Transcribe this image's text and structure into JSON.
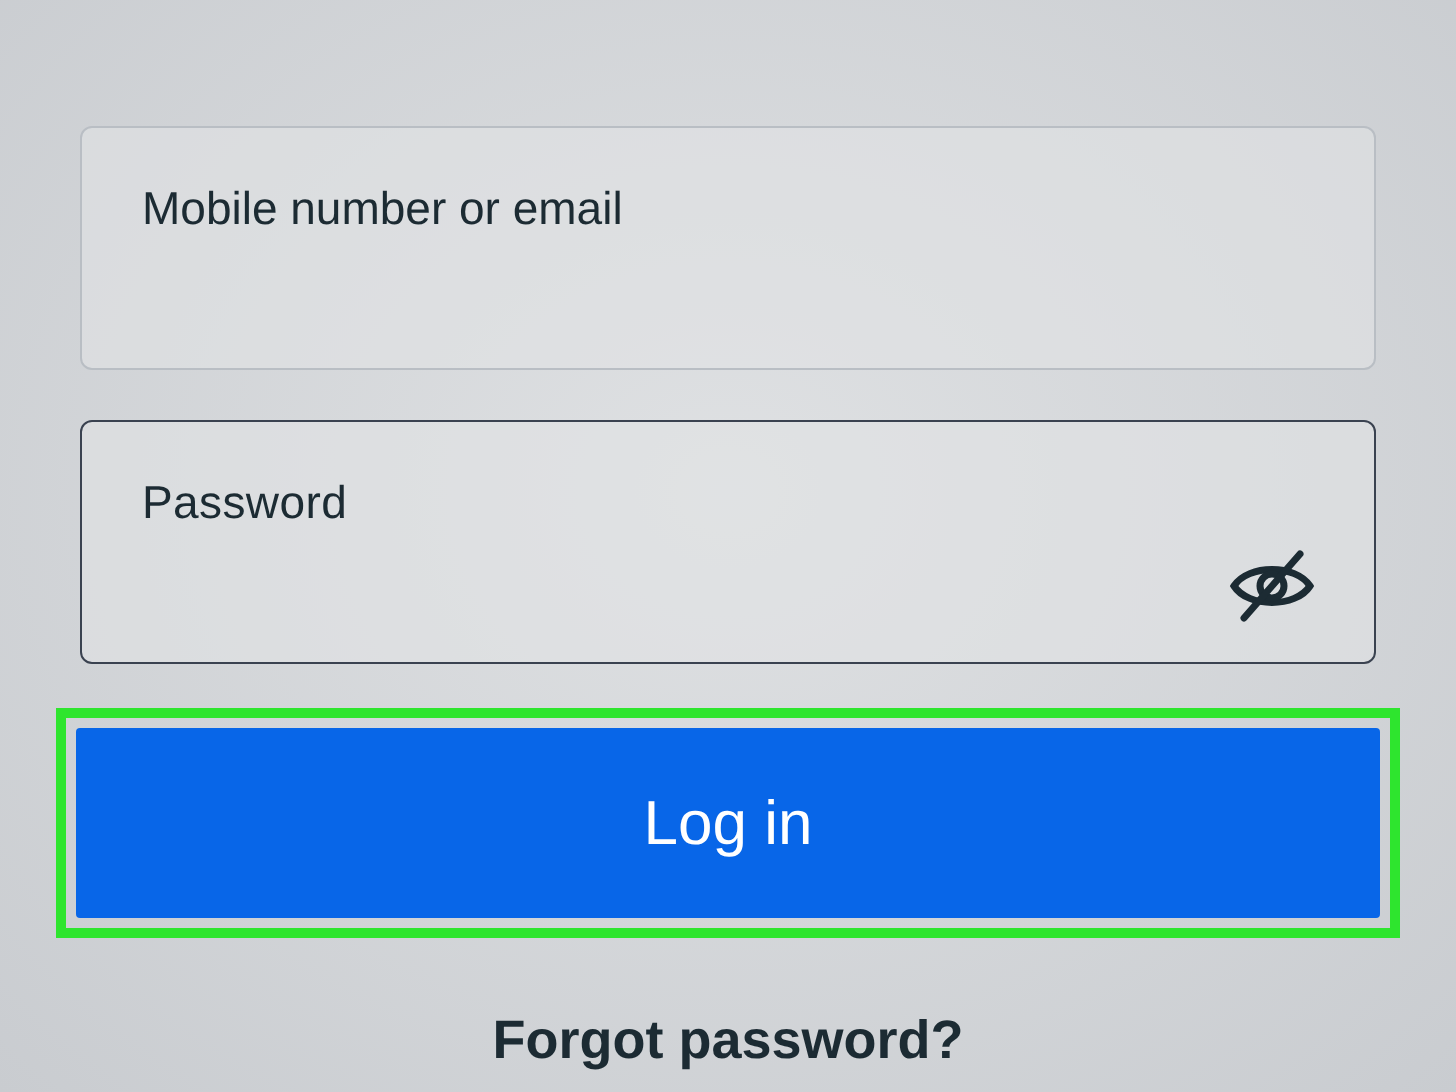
{
  "fields": [
    {
      "placeholder": "Mobile number or email",
      "kind": "text",
      "focused": false
    },
    {
      "placeholder": "Password",
      "kind": "password",
      "focused": true
    }
  ],
  "login_button": {
    "label": "Log in",
    "highlighted": true
  },
  "forgot_link": "Forgot password?"
}
